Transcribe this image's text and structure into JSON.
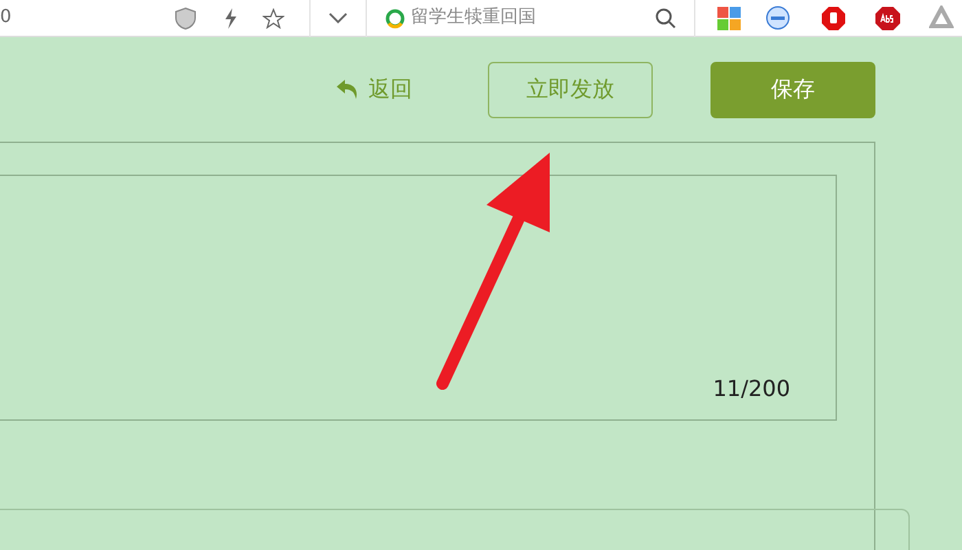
{
  "browser_toolbar": {
    "address_text": "0",
    "search_text": "留学生犊重回国"
  },
  "actions": {
    "back_link": "返回",
    "publish_button": "立即发放",
    "save_button": "保存"
  },
  "form": {
    "textarea_counter": "11/200"
  }
}
